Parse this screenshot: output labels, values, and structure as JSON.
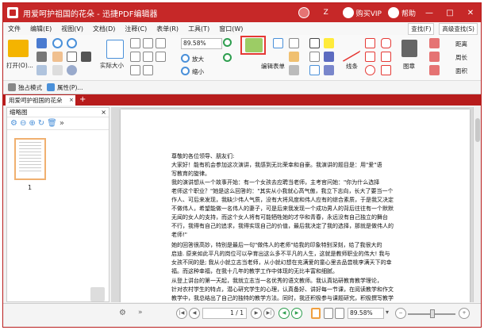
{
  "window": {
    "title": "用爱呵护祖国的花朵 - 迅捷PDF编辑器",
    "z_label": "Z",
    "vip_label": "购买VIP",
    "help_label": "帮助"
  },
  "menu": {
    "items": [
      "文件",
      "编辑(E)",
      "视图(V)",
      "文档(D)",
      "注释(C)",
      "表单(R)",
      "工具(T)",
      "窗口(W)"
    ],
    "search_label": "查找(F)",
    "advanced_search_label": "高级查找(S)"
  },
  "ribbon": {
    "open_label": "打开(O)...",
    "actual_size_label": "实际大小",
    "zoom_value": "89.58%",
    "zoom_in_label": "放大",
    "zoom_out_label": "缩小",
    "edit_form_label": "编辑表单",
    "line_label": "线条",
    "shape_label": "图章",
    "distance_label": "距离",
    "perimeter_label": "周长",
    "area_label": "面积"
  },
  "subbar": {
    "exclusive_mode_label": "独占模式",
    "properties_label": "属性(P)..."
  },
  "tabs": {
    "active_label": "用爱呵护祖国的花朵",
    "close_glyph": "×",
    "add_glyph": "+"
  },
  "thumbnail_panel": {
    "title": "缩略图",
    "page_number": "1",
    "close_glyph": "×"
  },
  "document": {
    "lines": [
      "尊敬的各位领导、朋友们:",
      "    大家好！能有机会参加这次演讲，我感到无比荣幸和自豪。我演讲的题目是：用\"爱\"语",
      "写教育的旋律。",
      "    我的演讲想从一个故事开始：有一个女孩去应聘当老师，主考官问她：\"你为什么选择",
      "老师这个职业？\"她是这么回答的：\"其实从小我就心高气傲，我立下志向，长大了要当一个",
      "作人、可后来发现，我缺少伟人气质，没有大将风度和伟人应有的综合素质，于是我又决定",
      "不做伟人，希望能做一名伟人的妻子，可是后来我发现一个成功男人的背后往往有一个默默",
      "无闻的女人的支持，而这个女人将有可能牺牲她的才华和青春，永远没有自己独立的舞台",
      "不行，我得有自己的追求，我得实现自己的价值，最后我决定了我的选择，那就是做伟人的",
      "老师!\"",
      "    她的回答很高妙，特别是最后一句\"做伟人的老师\"给我的印象特别深刻，给了我很大的",
      "启迪. 原来如此平凡的岗位可以孕育出这么多不平凡的人生，这就是教师职业的伟大! 我与",
      "女孩不同的是; 我从小就立志当老师，从小就幻想在充满爱的童心里去品尝桃李满天下的幸",
      "福。而这种幸福，在我十几年的教学工作中体现的无比丰富和细腻。",
      "    从登上讲台的第一天起，我就立志当一名优秀的语文教师。我认真钻研教育教学理论，",
      "针对农村学生的特点，潜心研究学生的心理，认真备好、讲好每一节课，在阅读教学和作文",
      "教学中，我总结出了自己的独特的教学方法。同时，我还积极参与课题研究，积极撰写教学"
    ]
  },
  "statusbar": {
    "page_value": "1 / 1",
    "zoom_value": "89.58%"
  }
}
